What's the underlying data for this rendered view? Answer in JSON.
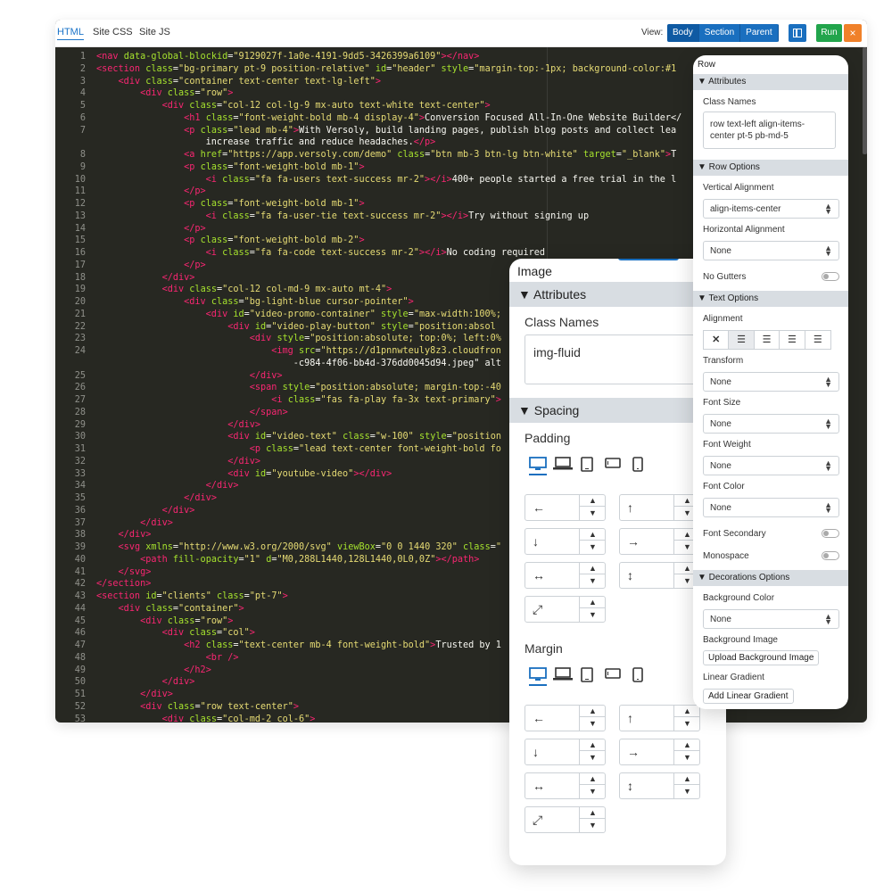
{
  "editor": {
    "tabs": [
      "HTML",
      "Site CSS",
      "Site JS"
    ],
    "view_label": "View:",
    "view_options": [
      "Body",
      "Section",
      "Parent"
    ],
    "run_label": "Run",
    "close_label": "×",
    "code_lines": [
      {
        "n": "1",
        "t": "<nav data-global-blockid=\"9129027f-1a0e-4191-9dd5-3426399a6109\"></nav>"
      },
      {
        "n": "2",
        "t": "<section class=\"bg-primary pt-9 position-relative\" id=\"header\" style=\"margin-top:-1px; background-color:#1"
      },
      {
        "n": "3",
        "t": "    <div class=\"container text-center text-lg-left\">"
      },
      {
        "n": "4",
        "t": "        <div class=\"row\">"
      },
      {
        "n": "5",
        "t": "            <div class=\"col-12 col-lg-9 mx-auto text-white text-center\">"
      },
      {
        "n": "6",
        "t": "                <h1 class=\"font-weight-bold mb-4 display-4\">Conversion Focused All-In-One Website Builder</"
      },
      {
        "n": "7",
        "t": "                <p class=\"lead mb-4\">With Versoly, build landing pages, publish blog posts and collect lea"
      },
      {
        "n": "",
        "t": "                    increase traffic and reduce headaches.</p>"
      },
      {
        "n": "8",
        "t": "                <a href=\"https://app.versoly.com/demo\" class=\"btn mb-3 btn-lg btn-white\" target=\"_blank\">T"
      },
      {
        "n": "9",
        "t": "                <p class=\"font-weight-bold mb-1\">"
      },
      {
        "n": "10",
        "t": "                    <i class=\"fa fa-users text-success mr-2\"></i>400+ people started a free trial in the l"
      },
      {
        "n": "11",
        "t": "                </p>"
      },
      {
        "n": "12",
        "t": "                <p class=\"font-weight-bold mb-1\">"
      },
      {
        "n": "13",
        "t": "                    <i class=\"fa fa-user-tie text-success mr-2\"></i>Try without signing up"
      },
      {
        "n": "14",
        "t": "                </p>"
      },
      {
        "n": "15",
        "t": "                <p class=\"font-weight-bold mb-2\">"
      },
      {
        "n": "16",
        "t": "                    <i class=\"fa fa-code text-success mr-2\"></i>No coding required"
      },
      {
        "n": "17",
        "t": "                </p>"
      },
      {
        "n": "18",
        "t": "            </div>"
      },
      {
        "n": "19",
        "t": "            <div class=\"col-12 col-md-9 mx-auto mt-4\">"
      },
      {
        "n": "20",
        "t": "                <div class=\"bg-light-blue cursor-pointer\">"
      },
      {
        "n": "21",
        "t": "                    <div id=\"video-promo-container\" style=\"max-width:100%;"
      },
      {
        "n": "22",
        "t": "                        <div id=\"video-play-button\" style=\"position:absol"
      },
      {
        "n": "23",
        "t": "                            <div style=\"position:absolute; top:0%; left:0%"
      },
      {
        "n": "24",
        "t": "                                <img src=\"https://d1pnnwteuly8z3.cloudfron"
      },
      {
        "n": "",
        "t": "                                    -c984-4f06-bb4d-376dd0045d94.jpeg\" alt"
      },
      {
        "n": "25",
        "t": "                            </div>"
      },
      {
        "n": "26",
        "t": "                            <span style=\"position:absolute; margin-top:-40"
      },
      {
        "n": "27",
        "t": "                                <i class=\"fas fa-play fa-3x text-primary\">"
      },
      {
        "n": "28",
        "t": "                            </span>"
      },
      {
        "n": "29",
        "t": "                        </div>"
      },
      {
        "n": "30",
        "t": "                        <div id=\"video-text\" class=\"w-100\" style=\"position"
      },
      {
        "n": "31",
        "t": "                            <p class=\"lead text-center font-weight-bold fo"
      },
      {
        "n": "32",
        "t": "                        </div>"
      },
      {
        "n": "33",
        "t": "                        <div id=\"youtube-video\"></div>"
      },
      {
        "n": "34",
        "t": "                    </div>"
      },
      {
        "n": "35",
        "t": "                </div>"
      },
      {
        "n": "36",
        "t": "            </div>"
      },
      {
        "n": "37",
        "t": "        </div>"
      },
      {
        "n": "38",
        "t": "    </div>"
      },
      {
        "n": "39",
        "t": "    <svg xmlns=\"http://www.w3.org/2000/svg\" viewBox=\"0 0 1440 320\" class=\""
      },
      {
        "n": "40",
        "t": "        <path fill-opacity=\"1\" d=\"M0,288L1440,128L1440,0L0,0Z\"></path>"
      },
      {
        "n": "41",
        "t": "    </svg>"
      },
      {
        "n": "42",
        "t": "</section>"
      },
      {
        "n": "43",
        "t": "<section id=\"clients\" class=\"pt-7\">"
      },
      {
        "n": "44",
        "t": "    <div class=\"container\">"
      },
      {
        "n": "45",
        "t": "        <div class=\"row\">"
      },
      {
        "n": "46",
        "t": "            <div class=\"col\">"
      },
      {
        "n": "47",
        "t": "                <h2 class=\"text-center mb-4 font-weight-bold\">Trusted by 1"
      },
      {
        "n": "48",
        "t": "                    <br />"
      },
      {
        "n": "49",
        "t": "                </h2>"
      },
      {
        "n": "50",
        "t": "            </div>"
      },
      {
        "n": "51",
        "t": "        </div>"
      },
      {
        "n": "52",
        "t": "        <div class=\"row text-center\">"
      },
      {
        "n": "53",
        "t": "            <div class=\"col-md-2 col-6\">"
      }
    ]
  },
  "row_panel": {
    "title": "Row",
    "attributes_header": "▼ Attributes",
    "class_names_label": "Class Names",
    "class_names_value": "row text-left align-items-center pt-5 pb-md-5",
    "row_options_header": "▼ Row Options",
    "vertical_alignment_label": "Vertical Alignment",
    "vertical_alignment_value": "align-items-center",
    "horizontal_alignment_label": "Horizontal Alignment",
    "horizontal_alignment_value": "None",
    "no_gutters_label": "No Gutters",
    "text_options_header": "▼ Text Options",
    "alignment_label": "Alignment",
    "transform_label": "Transform",
    "transform_value": "None",
    "font_size_label": "Font Size",
    "font_size_value": "None",
    "font_weight_label": "Font Weight",
    "font_weight_value": "None",
    "font_color_label": "Font Color",
    "font_color_value": "None",
    "font_secondary_label": "Font Secondary",
    "monospace_label": "Monospace",
    "decorations_header": "▼ Decorations Options",
    "background_color_label": "Background Color",
    "background_color_value": "None",
    "background_image_label": "Background Image",
    "upload_bg_button": "Upload Background Image",
    "linear_gradient_label": "Linear Gradient",
    "add_gradient_button": "Add Linear Gradient"
  },
  "image_panel": {
    "title": "Image",
    "attributes_header": "▼ Attributes",
    "class_names_label": "Class Names",
    "class_names_value": "img-fluid",
    "spacing_header": "▼ Spacing",
    "padding_label": "Padding",
    "margin_label": "Margin"
  },
  "icons": {
    "alignment": [
      "close-icon",
      "align-left-icon",
      "align-center-icon",
      "align-right-icon",
      "align-justify-icon"
    ],
    "devices": [
      "desktop-icon",
      "laptop-icon",
      "tablet-icon",
      "tablet-landscape-icon",
      "mobile-icon"
    ],
    "spacing": [
      "arrow-left-icon",
      "arrow-up-icon",
      "arrow-down-icon",
      "arrow-right-icon",
      "arrows-horizontal-icon",
      "arrows-vertical-icon",
      "expand-icon"
    ]
  },
  "colors": {
    "accent": "#1a6fbf",
    "run": "#22a54c",
    "close": "#f0812a",
    "editor_bg": "#272822"
  }
}
